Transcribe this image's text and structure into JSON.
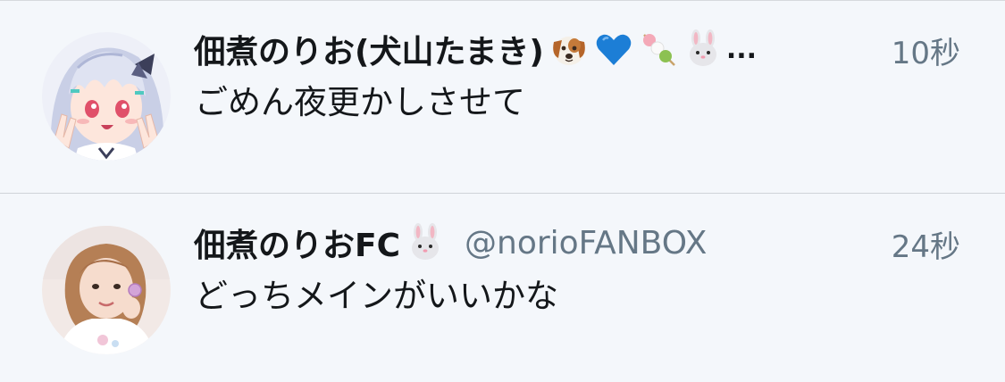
{
  "timeline": {
    "tweets": [
      {
        "display_name": "佃煮のりお(犬山たまき)",
        "name_emojis": [
          "dog-face-emoji",
          "blue-heart-emoji",
          "dango-emoji",
          "rabbit-face-emoji"
        ],
        "ellipsis": "...",
        "handle": "",
        "timestamp": "10秒",
        "text": "ごめん夜更かしさせて",
        "avatar": "anime-girl-avatar"
      },
      {
        "display_name": "佃煮のりおFC",
        "name_emojis": [
          "rabbit-face-emoji"
        ],
        "handle": "@norioFANBOX",
        "timestamp": "24秒",
        "text": "どっちメインがいいかな",
        "avatar": "photo-avatar"
      }
    ]
  },
  "colors": {
    "background": "#f4f7fb",
    "primary_text": "#14171a",
    "secondary_text": "#657786",
    "divider": "#cfd3d8"
  }
}
